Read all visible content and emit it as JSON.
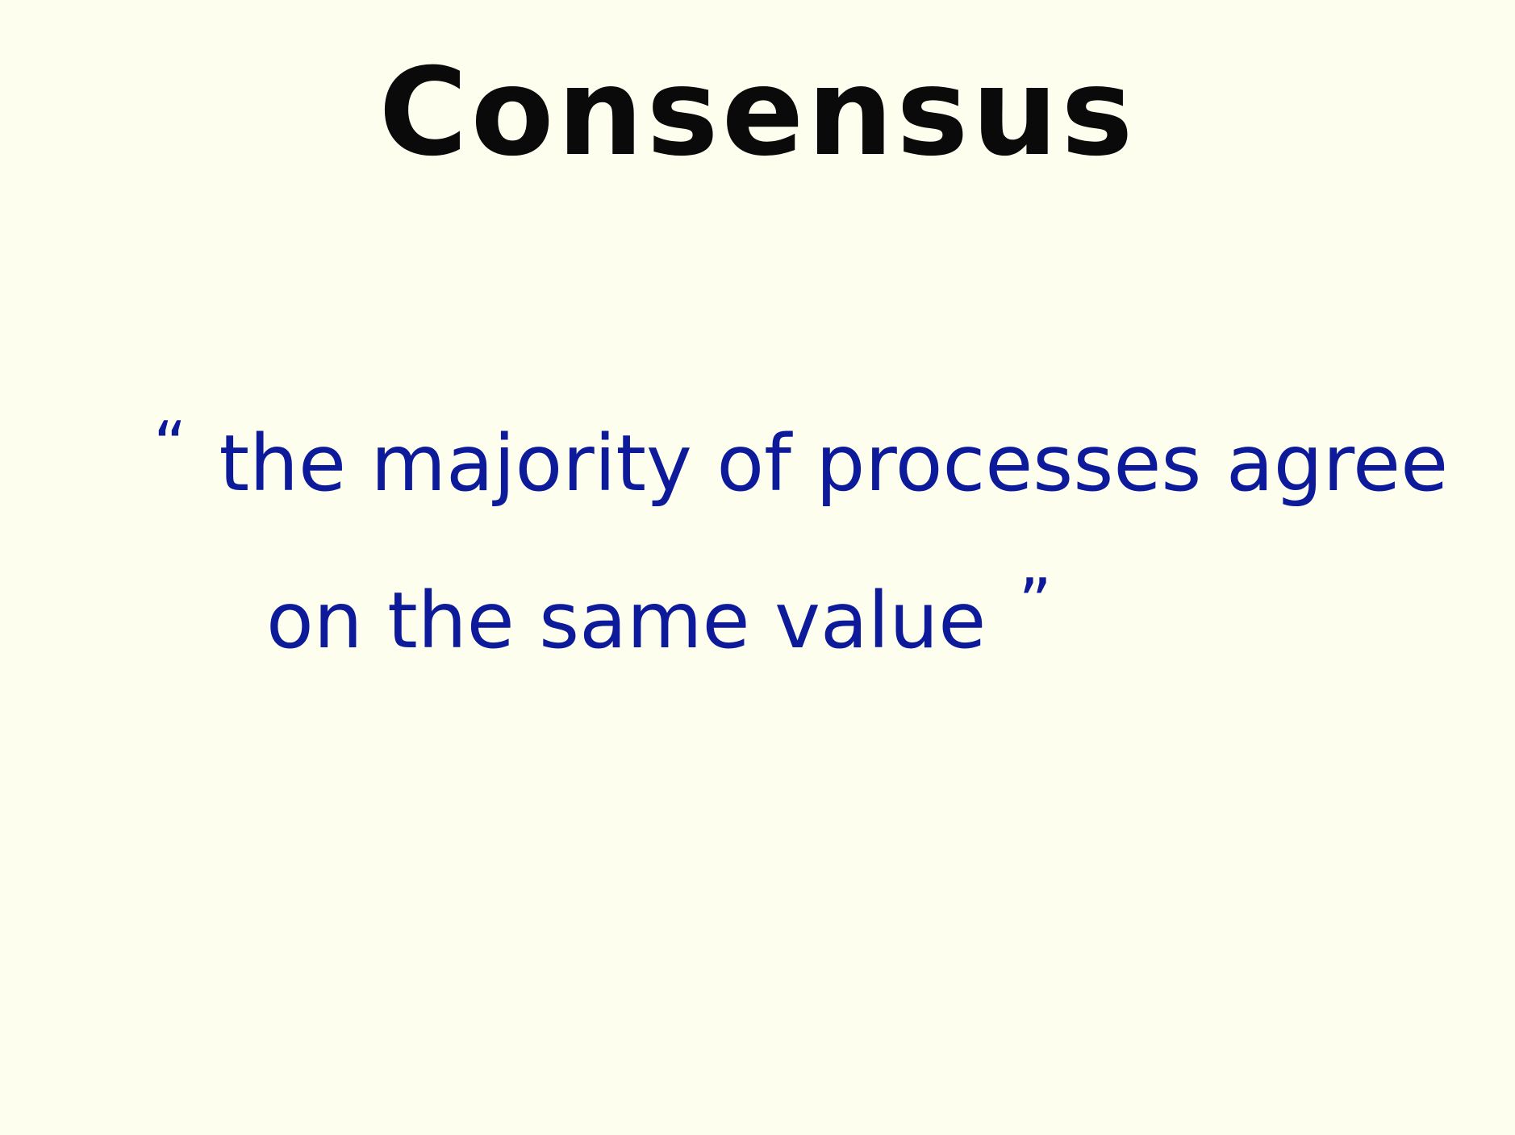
{
  "slide": {
    "title": "Consensus",
    "quote": {
      "open_mark": "“",
      "line_1": "the majority of processes agree",
      "line_2": "on the same value",
      "close_mark": "”"
    }
  },
  "colors": {
    "background": "#fefeee",
    "title_ink": "#0a0a0a",
    "quote_ink": "#0d1a9a"
  }
}
